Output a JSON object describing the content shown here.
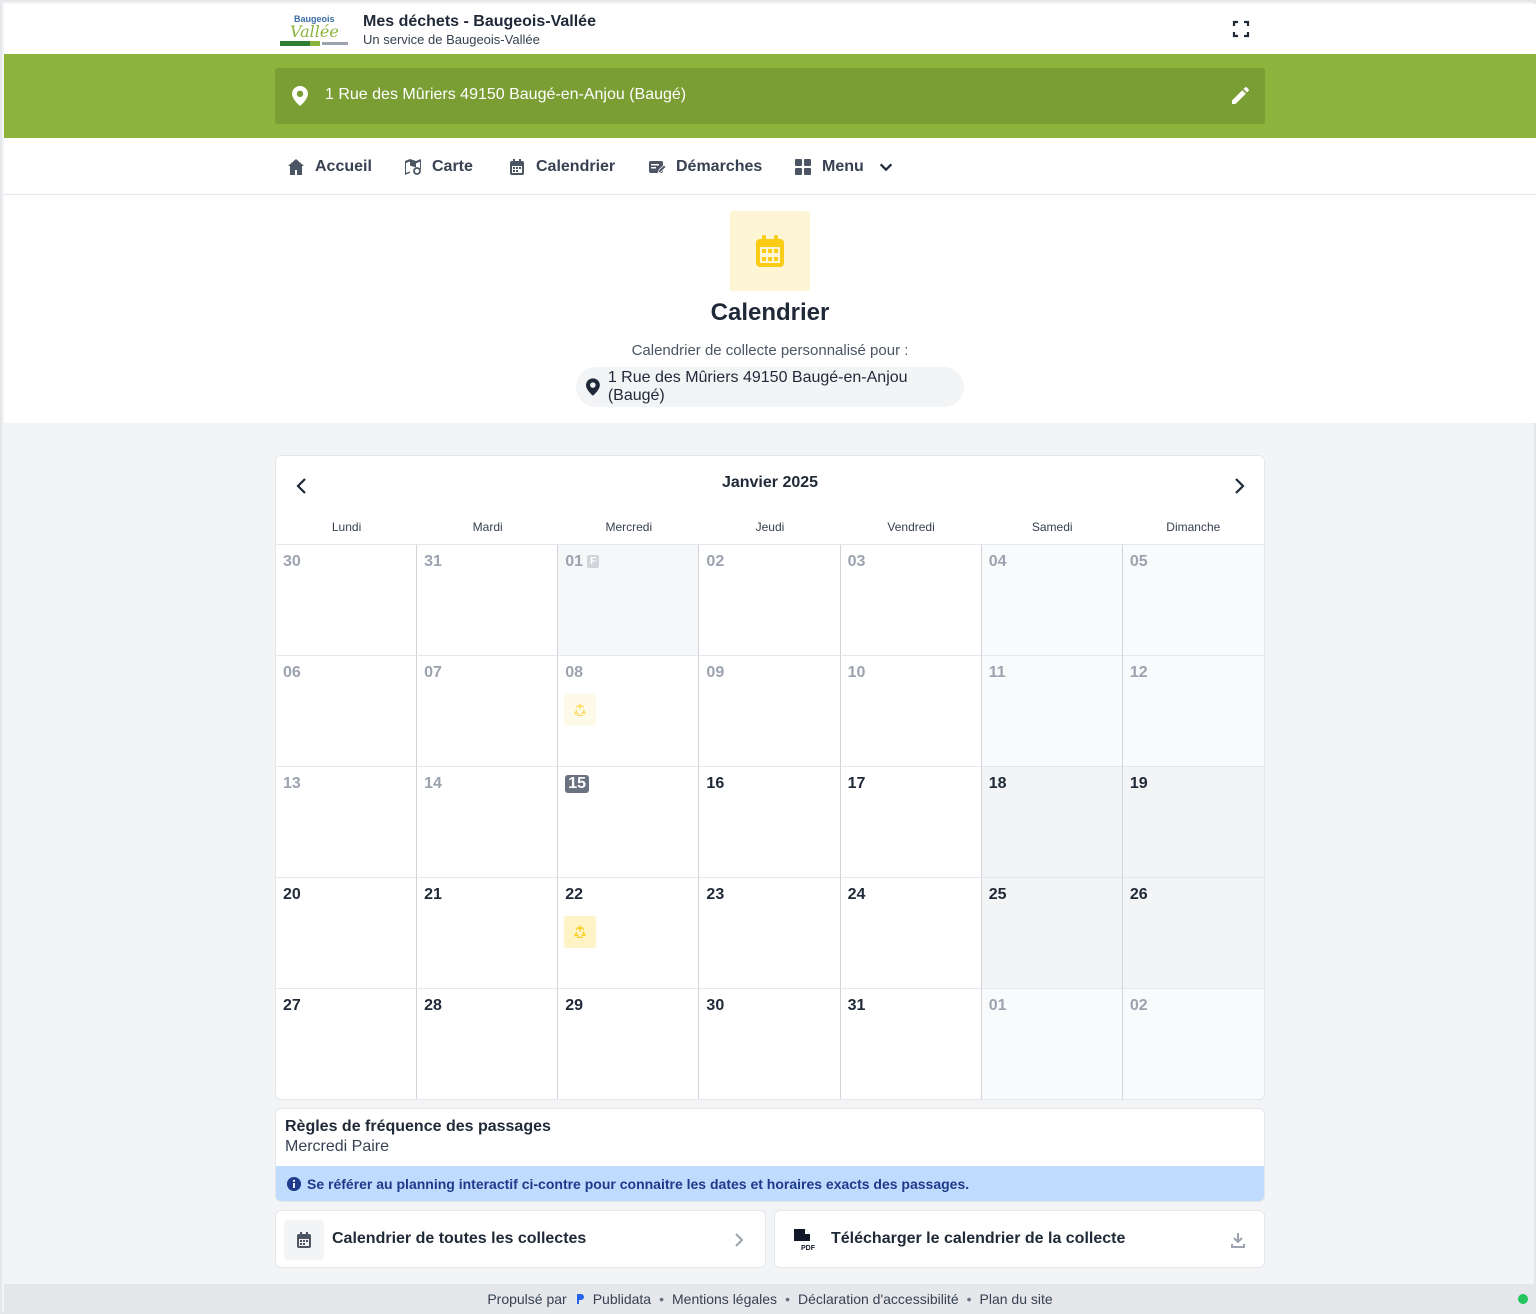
{
  "header": {
    "logo_text": "Baugeois Vallée",
    "title": "Mes déchets - Baugeois-Vallée",
    "subtitle": "Un service de Baugeois-Vallée"
  },
  "address_bar": {
    "address": "1 Rue des Mûriers 49150 Baugé-en-Anjou (Baugé)"
  },
  "nav": {
    "items": [
      {
        "label": "Accueil",
        "icon": "home-icon"
      },
      {
        "label": "Carte",
        "icon": "map-icon"
      },
      {
        "label": "Calendrier",
        "icon": "calendar-icon"
      },
      {
        "label": "Démarches",
        "icon": "form-edit-icon"
      },
      {
        "label": "Menu",
        "icon": "grid-icon"
      }
    ]
  },
  "hero": {
    "title": "Calendrier",
    "subtitle": "Calendrier de collecte personnalisé pour :",
    "address": "1 Rue des Mûriers 49150 Baugé-en-Anjou (Baugé)"
  },
  "calendar": {
    "month": "Janvier 2025",
    "weekdays": [
      "Lundi",
      "Mardi",
      "Mercredi",
      "Jeudi",
      "Vendredi",
      "Samedi",
      "Dimanche"
    ],
    "holiday_badge": "F",
    "days": [
      {
        "n": "30",
        "muted": true
      },
      {
        "n": "31",
        "muted": true
      },
      {
        "n": "01",
        "muted": true,
        "holiday": true
      },
      {
        "n": "02",
        "muted": true
      },
      {
        "n": "03",
        "muted": true
      },
      {
        "n": "04",
        "muted": true
      },
      {
        "n": "05",
        "muted": true
      },
      {
        "n": "06",
        "muted": true
      },
      {
        "n": "07",
        "muted": true
      },
      {
        "n": "08",
        "muted": true,
        "collect": true
      },
      {
        "n": "09",
        "muted": true
      },
      {
        "n": "10",
        "muted": true
      },
      {
        "n": "11",
        "muted": true
      },
      {
        "n": "12",
        "muted": true
      },
      {
        "n": "13",
        "muted": true
      },
      {
        "n": "14",
        "muted": true
      },
      {
        "n": "15",
        "today": true
      },
      {
        "n": "16"
      },
      {
        "n": "17"
      },
      {
        "n": "18"
      },
      {
        "n": "19"
      },
      {
        "n": "20"
      },
      {
        "n": "21"
      },
      {
        "n": "22",
        "collect": true
      },
      {
        "n": "23"
      },
      {
        "n": "24"
      },
      {
        "n": "25"
      },
      {
        "n": "26"
      },
      {
        "n": "27"
      },
      {
        "n": "28"
      },
      {
        "n": "29"
      },
      {
        "n": "30"
      },
      {
        "n": "31"
      },
      {
        "n": "01",
        "muted": true
      },
      {
        "n": "02",
        "muted": true
      }
    ]
  },
  "rules": {
    "title": "Règles de fréquence des passages",
    "value": "Mercredi Paire",
    "info": "Se référer au planning interactif ci-contre pour connaitre les dates et horaires exacts des passages."
  },
  "cards": {
    "all_collections": "Calendrier de toutes les collectes",
    "download": "Télécharger le calendrier de la collecte"
  },
  "footer": {
    "powered": "Propulsé par",
    "provider": "Publidata",
    "legal": "Mentions légales",
    "accessibility": "Déclaration d'accessibilité",
    "sitemap": "Plan du site"
  },
  "colors": {
    "brand_green": "#8cb43c",
    "collect_yellow": "#facc15",
    "info_blue": "#bfdbfe"
  }
}
